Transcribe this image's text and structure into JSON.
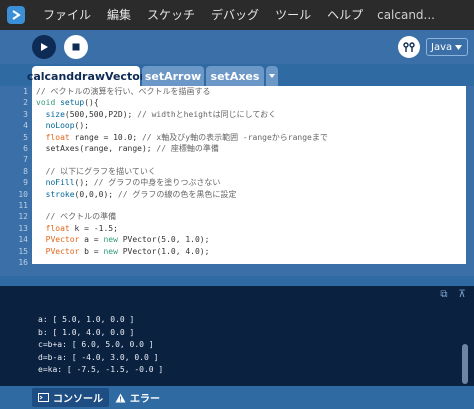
{
  "menubar": {
    "app_icon": "processing-icon",
    "items": [
      "ファイル",
      "編集",
      "スケッチ",
      "デバッグ",
      "ツール",
      "ヘルプ"
    ],
    "title": "calcand..."
  },
  "toolbar": {
    "run_icon": "play-icon",
    "stop_icon": "stop-icon",
    "debug_icon": "debugger-icon",
    "mode": "Java"
  },
  "tabs": [
    {
      "label": "calcanddrawVector",
      "active": true
    },
    {
      "label": "setArrow",
      "active": false
    },
    {
      "label": "setAxes",
      "active": false
    }
  ],
  "tab_menu_icon": "chevron-down-icon",
  "editor": {
    "line_numbers": [
      "1",
      "2",
      "3",
      "4",
      "5",
      "6",
      "7",
      "8",
      "9",
      "10",
      "11",
      "12",
      "13",
      "14",
      "15",
      "16"
    ],
    "lines": [
      [
        {
          "t": "// ベクトルの演算を行い、ベクトルを描画する",
          "c": "#666666"
        }
      ],
      [
        {
          "t": "void ",
          "c": "#33997e"
        },
        {
          "t": "setup",
          "c": "#006699"
        },
        {
          "t": "(){",
          "c": "#333333"
        }
      ],
      [
        {
          "t": "  ",
          "c": "#333"
        },
        {
          "t": "size",
          "c": "#006699"
        },
        {
          "t": "(500,500,P2D); ",
          "c": "#333333"
        },
        {
          "t": "// widthとheightは同じにしておく",
          "c": "#666666"
        }
      ],
      [
        {
          "t": "  ",
          "c": "#333"
        },
        {
          "t": "noLoop",
          "c": "#006699"
        },
        {
          "t": "();",
          "c": "#333333"
        }
      ],
      [
        {
          "t": "  ",
          "c": "#333"
        },
        {
          "t": "float",
          "c": "#e2661a"
        },
        {
          "t": " range = 10.0; ",
          "c": "#333333"
        },
        {
          "t": "// x軸及びy軸の表示範囲 -rangeからrangeまで",
          "c": "#666666"
        }
      ],
      [
        {
          "t": "  setAxes(range, range); ",
          "c": "#333333"
        },
        {
          "t": "// 座標軸の準備",
          "c": "#666666"
        }
      ],
      [
        {
          "t": "",
          "c": "#333"
        }
      ],
      [
        {
          "t": "  ",
          "c": "#333"
        },
        {
          "t": "// 以下にグラフを描いていく",
          "c": "#666666"
        }
      ],
      [
        {
          "t": "  ",
          "c": "#333"
        },
        {
          "t": "noFill",
          "c": "#006699"
        },
        {
          "t": "(); ",
          "c": "#333333"
        },
        {
          "t": "// グラフの中身を塗りつぶさない",
          "c": "#666666"
        }
      ],
      [
        {
          "t": "  ",
          "c": "#333"
        },
        {
          "t": "stroke",
          "c": "#006699"
        },
        {
          "t": "(0,0,0); ",
          "c": "#333333"
        },
        {
          "t": "// グラフの線の色を黒色に設定",
          "c": "#666666"
        }
      ],
      [
        {
          "t": "",
          "c": "#333"
        }
      ],
      [
        {
          "t": "  ",
          "c": "#333"
        },
        {
          "t": "// ベクトルの準備",
          "c": "#666666"
        }
      ],
      [
        {
          "t": "  ",
          "c": "#333"
        },
        {
          "t": "float",
          "c": "#e2661a"
        },
        {
          "t": " k = -1.5;",
          "c": "#333333"
        }
      ],
      [
        {
          "t": "  ",
          "c": "#333"
        },
        {
          "t": "PVector",
          "c": "#e2661a"
        },
        {
          "t": " a = ",
          "c": "#333333"
        },
        {
          "t": "new",
          "c": "#33997e"
        },
        {
          "t": " PVector(5.0, 1.0);",
          "c": "#333333"
        }
      ],
      [
        {
          "t": "  ",
          "c": "#333"
        },
        {
          "t": "PVector",
          "c": "#e2661a"
        },
        {
          "t": " b = ",
          "c": "#333333"
        },
        {
          "t": "new",
          "c": "#33997e"
        },
        {
          "t": " PVector(1.0, 4.0);",
          "c": "#333333"
        }
      ],
      [
        {
          "t": "",
          "c": "#333"
        }
      ]
    ]
  },
  "console": {
    "lines": [
      "a: [ 5.0, 1.0, 0.0 ]",
      "b: [ 1.0, 4.0, 0.0 ]",
      "c=b+a: [ 6.0, 5.0, 0.0 ]",
      "d=b-a: [ -4.0, 3.0, 0.0 ]",
      "e=ka: [ -7.5, -1.5, -0.0 ]"
    ],
    "copy_icon": "copy-icon",
    "clear_icon": "clear-icon"
  },
  "statusbar": {
    "console_label": "コンソール",
    "console_icon": "console-icon",
    "errors_label": "エラー",
    "errors_icon": "warning-icon"
  },
  "colors": {
    "menubar": "#2b2b2b",
    "toolbar": "#3b6fa8",
    "console_bg": "#0b2140",
    "keyword": "#33997e",
    "function": "#006699",
    "type": "#e2661a",
    "comment": "#666666"
  }
}
